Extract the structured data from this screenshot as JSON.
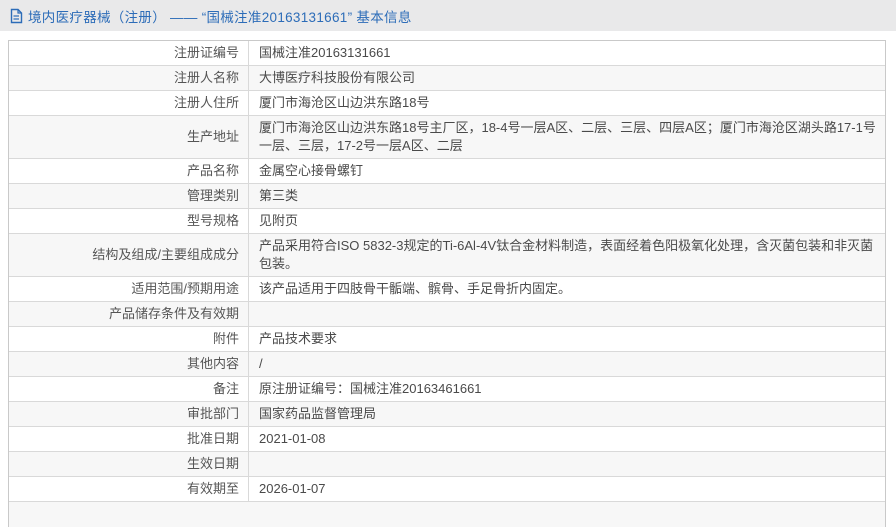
{
  "header": {
    "icon": "document-icon",
    "title": "境内医疗器械（注册） —— “国械注准20163131661” 基本信息"
  },
  "colors": {
    "accent_blue": "#2c6cb8",
    "header_bg": "#e9e9ea",
    "row_alt_bg": "#f7f7f7",
    "table_border": "#c9c9c9",
    "row_border": "#d9d9d9",
    "label_text": "#555555",
    "value_text": "#4a4a4a"
  },
  "table": {
    "rows": [
      {
        "label": "注册证编号",
        "value": "国械注准20163131661"
      },
      {
        "label": "注册人名称",
        "value": "大博医疗科技股份有限公司"
      },
      {
        "label": "注册人住所",
        "value": "厦门市海沧区山边洪东路18号"
      },
      {
        "label": "生产地址",
        "value": "厦门市海沧区山边洪东路18号主厂区，18-4号一层A区、二层、三层、四层A区；厦门市海沧区湖头路17-1号一层、三层，17-2号一层A区、二层"
      },
      {
        "label": "产品名称",
        "value": "金属空心接骨螺钉"
      },
      {
        "label": "管理类别",
        "value": "第三类"
      },
      {
        "label": "型号规格",
        "value": "见附页"
      },
      {
        "label": "结构及组成/主要组成成分",
        "value": "产品采用符合ISO 5832-3规定的Ti-6Al-4V钛合金材料制造，表面经着色阳极氧化处理，含灭菌包装和非灭菌包装。"
      },
      {
        "label": "适用范围/预期用途",
        "value": "该产品适用于四肢骨干骺端、髌骨、手足骨折内固定。"
      },
      {
        "label": "产品储存条件及有效期",
        "value": ""
      },
      {
        "label": "附件",
        "value": "产品技术要求"
      },
      {
        "label": "其他内容",
        "value": "/"
      },
      {
        "label": "备注",
        "value": "原注册证编号：国械注准20163461661"
      },
      {
        "label": "审批部门",
        "value": "国家药品监督管理局"
      },
      {
        "label": "批准日期",
        "value": "2021-01-08"
      },
      {
        "label": "生效日期",
        "value": ""
      },
      {
        "label": "有效期至",
        "value": "2026-01-07"
      }
    ]
  }
}
